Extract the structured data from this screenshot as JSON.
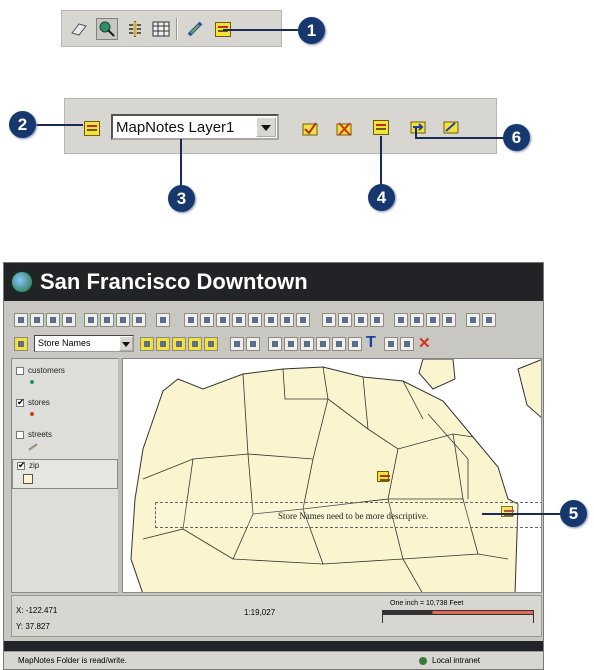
{
  "toolbar1": {
    "icons": [
      "eraser-icon",
      "identify-icon",
      "measure-icon",
      "table-icon",
      "hyperlink-icon",
      "mapnotes-icon"
    ]
  },
  "toolbar2": {
    "layer_select": "MapNotes Layer1",
    "icons": [
      "mapnotes-icon",
      "add-note-icon",
      "delete-note-icon",
      "edit-note-icon",
      "export-notes-icon",
      "import-notes-icon"
    ]
  },
  "callouts": [
    "1",
    "2",
    "3",
    "4",
    "5",
    "6"
  ],
  "app": {
    "title": "San Francisco Downtown",
    "layer_select": "Store Names",
    "toc": {
      "layers": [
        {
          "label": "customers",
          "checked": false
        },
        {
          "label": "stores",
          "checked": true
        },
        {
          "label": "streets",
          "checked": false
        },
        {
          "label": "zip",
          "checked": true
        }
      ]
    },
    "map": {
      "note_text": "Store Names need to be more descriptive."
    },
    "footer": {
      "x_coord": "X: -122.471",
      "y_coord": "Y: 37.827",
      "scale": "1:19,027",
      "scalebar_label": "One inch = 10,738 Feet"
    },
    "status": {
      "message": "MapNotes Folder is read/write.",
      "zone": "Local intranet"
    }
  },
  "colors": {
    "callout": "#16386e",
    "map_polygon": "#faf5cf",
    "title_bar": "#222326",
    "highlight": "#e06a5a"
  }
}
